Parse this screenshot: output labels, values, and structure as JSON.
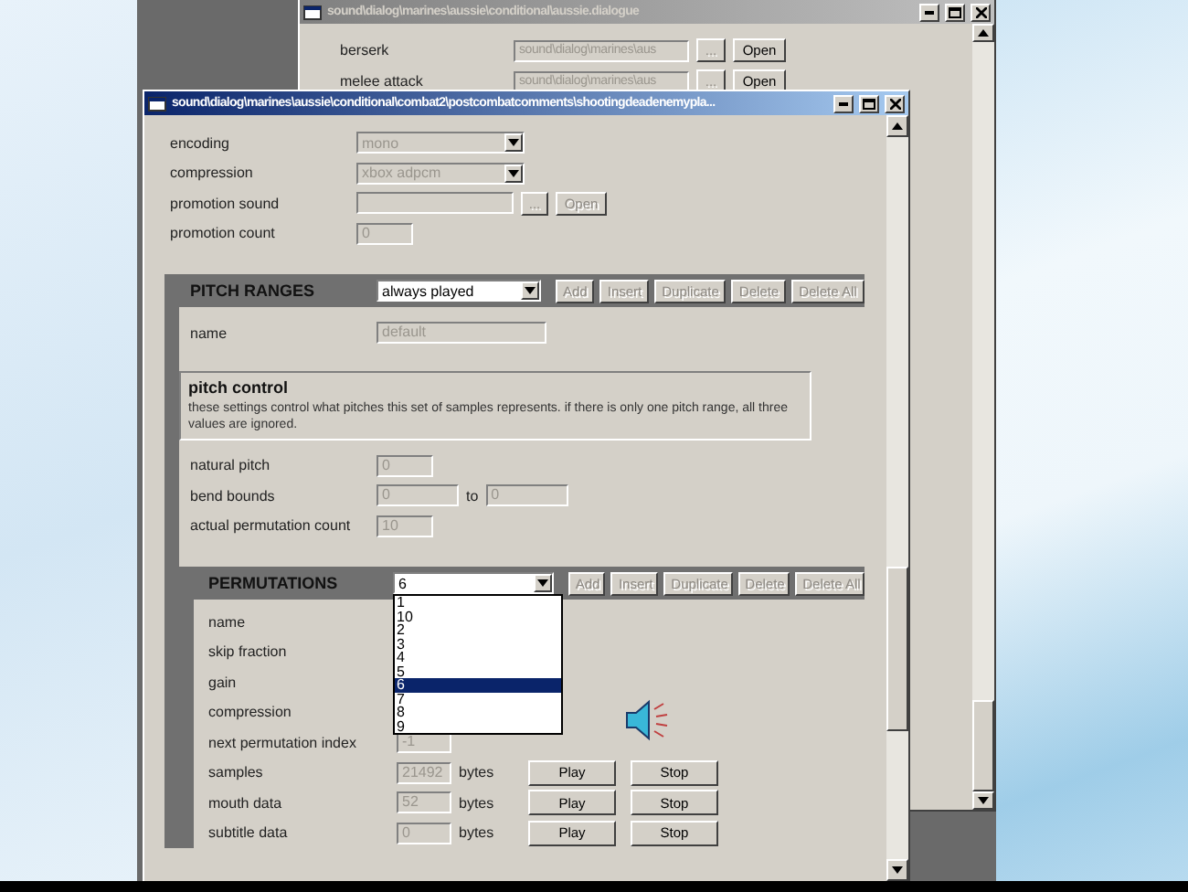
{
  "back_window": {
    "title": "sound\\dialog\\marines\\aussie\\conditional\\aussie.dialogue",
    "rows": [
      {
        "label": "berserk",
        "value": "sound\\dialog\\marines\\aus",
        "browse": "...",
        "button": "Open"
      },
      {
        "label": "melee attack",
        "value": "sound\\dialog\\marines\\aus",
        "browse": "...",
        "button": "Open"
      }
    ]
  },
  "window": {
    "title": "sound\\dialog\\marines\\aussie\\conditional\\combat2\\postcombatcomments\\shootingdeadenemypla...",
    "fields": [
      {
        "kind": "select",
        "label": "encoding",
        "value": "mono",
        "disabled": true
      },
      {
        "kind": "select",
        "label": "compression",
        "value": "xbox adpcm",
        "disabled": true
      },
      {
        "kind": "file",
        "label": "promotion sound",
        "browse": "...",
        "button": "Open",
        "disabled": true
      },
      {
        "kind": "text",
        "label": "promotion count",
        "value": "0",
        "disabled": true
      }
    ],
    "pitch_ranges": {
      "title": "PITCH RANGES",
      "selector": {
        "value": "always played",
        "disabled": false
      },
      "buttons": [
        {
          "label": "Add",
          "disabled": true
        },
        {
          "label": "Insert",
          "disabled": true
        },
        {
          "label": "Duplicate",
          "disabled": true
        },
        {
          "label": "Delete",
          "disabled": true
        },
        {
          "label": "Delete All",
          "disabled": true
        }
      ],
      "fields": [
        {
          "kind": "text",
          "label": "name",
          "value": "default",
          "disabled": true
        }
      ],
      "group": {
        "title": "pitch control",
        "description": "these settings control what pitches this set of samples represents. if there is only one pitch range, all three values are ignored."
      },
      "pitch_fields": [
        {
          "kind": "text",
          "label": "natural pitch",
          "value": "0",
          "disabled": true
        },
        {
          "kind": "range",
          "label": "bend bounds",
          "value": "0",
          "to": "to",
          "value_2": "0",
          "disabled": true
        },
        {
          "kind": "text",
          "label": "actual permutation count",
          "value": "10",
          "disabled": true
        }
      ],
      "permutations": {
        "title": "PERMUTATIONS",
        "selector": {
          "value": "6",
          "disabled": false,
          "expanded": true,
          "options": [
            {
              "label": "1",
              "selected": false
            },
            {
              "label": "10",
              "selected": false
            },
            {
              "label": "2",
              "selected": false
            },
            {
              "label": "3",
              "selected": false
            },
            {
              "label": "4",
              "selected": false
            },
            {
              "label": "5",
              "selected": false
            },
            {
              "label": "6",
              "selected": true
            },
            {
              "label": "7",
              "selected": false
            },
            {
              "label": "8",
              "selected": false
            },
            {
              "label": "9",
              "selected": false
            }
          ]
        },
        "buttons": [
          {
            "label": "Add",
            "disabled": true
          },
          {
            "label": "Insert",
            "disabled": true
          },
          {
            "label": "Duplicate",
            "disabled": true
          },
          {
            "label": "Delete",
            "disabled": true
          },
          {
            "label": "Delete All",
            "disabled": true
          }
        ],
        "fields": [
          {
            "kind": "label",
            "label": "name"
          },
          {
            "kind": "label",
            "label": "skip fraction"
          },
          {
            "kind": "label",
            "label": "gain"
          },
          {
            "kind": "label",
            "label": "compression"
          },
          {
            "kind": "text",
            "label": "next permutation index",
            "value": "-1",
            "disabled": true
          },
          {
            "kind": "data",
            "label": "samples",
            "value": "21492",
            "unit": "bytes",
            "disabled": true,
            "actions": [
              {
                "label": "Play",
                "disabled": false
              },
              {
                "label": "Stop",
                "disabled": false
              }
            ]
          },
          {
            "kind": "data",
            "label": "mouth data",
            "value": "52",
            "unit": "bytes",
            "disabled": true,
            "actions": [
              {
                "label": "Play",
                "disabled": false
              },
              {
                "label": "Stop",
                "disabled": false
              }
            ]
          },
          {
            "kind": "data",
            "label": "subtitle data",
            "value": "0",
            "unit": "bytes",
            "disabled": true,
            "actions": [
              {
                "label": "Play",
                "disabled": false
              },
              {
                "label": "Stop",
                "disabled": false
              }
            ]
          }
        ]
      }
    }
  }
}
